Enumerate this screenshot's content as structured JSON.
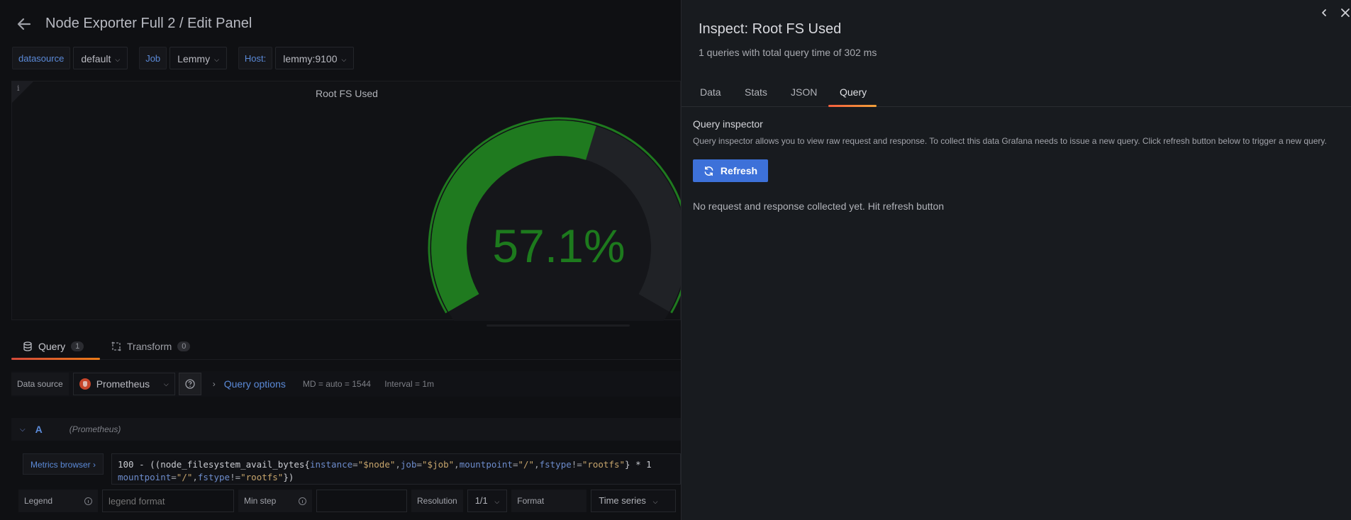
{
  "editor": {
    "title": "Node Exporter Full 2 / Edit Panel",
    "variables": [
      {
        "label": "datasource",
        "value": "default"
      },
      {
        "label": "Job",
        "value": "Lemmy"
      },
      {
        "label": "Host:",
        "value": "lemmy:9100"
      }
    ],
    "panel": {
      "title": "Root FS Used",
      "value_text": "57.1%",
      "gauge_fraction": 0.571,
      "gauge_color": "#1f7a1f",
      "info_glyph": "i"
    },
    "tabs": [
      {
        "label": "Query",
        "count": "1"
      },
      {
        "label": "Transform",
        "count": "0"
      }
    ],
    "datasource_row": {
      "label": "Data source",
      "value": "Prometheus",
      "query_options_label": "Query options",
      "md": "MD = auto = 1544",
      "interval": "Interval = 1m"
    },
    "query_row": {
      "ref": "A",
      "datasource": "(Prometheus)"
    },
    "metrics_browser_label": "Metrics browser",
    "query_lines": {
      "line1": [
        {
          "t": "fn",
          "v": "100 - ((node_filesystem_avail_bytes{"
        },
        {
          "t": "key",
          "v": "instance"
        },
        {
          "t": "op",
          "v": "="
        },
        {
          "t": "str",
          "v": "\"$node\""
        },
        {
          "t": "op",
          "v": ","
        },
        {
          "t": "key",
          "v": "job"
        },
        {
          "t": "op",
          "v": "="
        },
        {
          "t": "str",
          "v": "\"$job\""
        },
        {
          "t": "op",
          "v": ","
        },
        {
          "t": "key",
          "v": "mountpoint"
        },
        {
          "t": "op",
          "v": "="
        },
        {
          "t": "str",
          "v": "\"/\""
        },
        {
          "t": "op",
          "v": ","
        },
        {
          "t": "key",
          "v": "fstype"
        },
        {
          "t": "op",
          "v": "!="
        },
        {
          "t": "str",
          "v": "\"rootfs\""
        },
        {
          "t": "fn",
          "v": "} * 1"
        }
      ],
      "line2": [
        {
          "t": "key",
          "v": "mountpoint"
        },
        {
          "t": "op",
          "v": "="
        },
        {
          "t": "str",
          "v": "\"/\""
        },
        {
          "t": "op",
          "v": ","
        },
        {
          "t": "key",
          "v": "fstype"
        },
        {
          "t": "op",
          "v": "!="
        },
        {
          "t": "str",
          "v": "\"rootfs\""
        },
        {
          "t": "fn",
          "v": "})"
        }
      ]
    },
    "options_row": {
      "legend_label": "Legend",
      "legend_placeholder": "legend format",
      "min_step_label": "Min step",
      "resolution_label": "Resolution",
      "resolution_value": "1/1",
      "format_label": "Format",
      "format_value": "Time series"
    }
  },
  "drawer": {
    "title": "Inspect: Root FS Used",
    "subtitle": "1 queries with total query time of 302 ms",
    "tabs": [
      "Data",
      "Stats",
      "JSON",
      "Query"
    ],
    "active_tab": "Query",
    "inspector_title": "Query inspector",
    "inspector_desc": "Query inspector allows you to view raw request and response. To collect this data Grafana needs to issue a new query. Click refresh button below to trigger a new query.",
    "refresh_label": "Refresh",
    "empty_message": "No request and response collected yet. Hit refresh button"
  }
}
